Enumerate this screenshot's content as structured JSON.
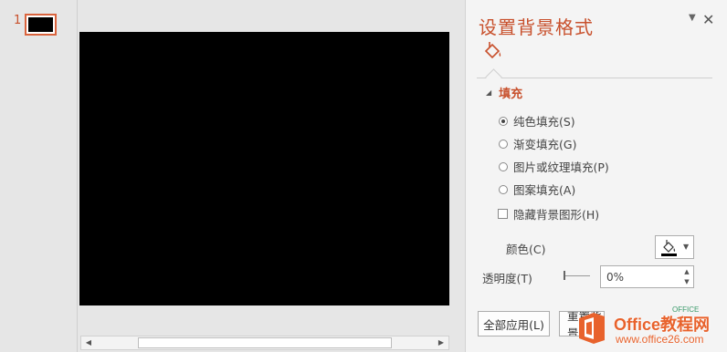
{
  "thumbnails": {
    "items": [
      {
        "number": "1"
      }
    ]
  },
  "pane": {
    "title": "设置背景格式",
    "menu_icon": "chevron-down-icon",
    "close_icon": "close-icon",
    "tab_icon": "paint-bucket-icon",
    "section": {
      "label": "填充",
      "expanded": true
    },
    "fill_options": [
      {
        "label": "纯色填充(S)",
        "checked": true
      },
      {
        "label": "渐变填充(G)",
        "checked": false
      },
      {
        "label": "图片或纹理填充(P)",
        "checked": false
      },
      {
        "label": "图案填充(A)",
        "checked": false
      }
    ],
    "hide_background": {
      "label": "隐藏背景图形(H)",
      "checked": false
    },
    "color": {
      "label": "颜色(C)",
      "value": "#000000"
    },
    "transparency": {
      "label": "透明度(T)",
      "value": "0%",
      "fraction": 0
    },
    "buttons": {
      "apply_all": "全部应用(L)",
      "reset": "重置背景(B)"
    }
  },
  "watermark": {
    "title": "Office教程网",
    "url": "www.office26.com",
    "badge": "OFFICE"
  },
  "colors": {
    "accent": "#c8502c",
    "slide_background": "#000000",
    "watermark": "#e8622c"
  }
}
